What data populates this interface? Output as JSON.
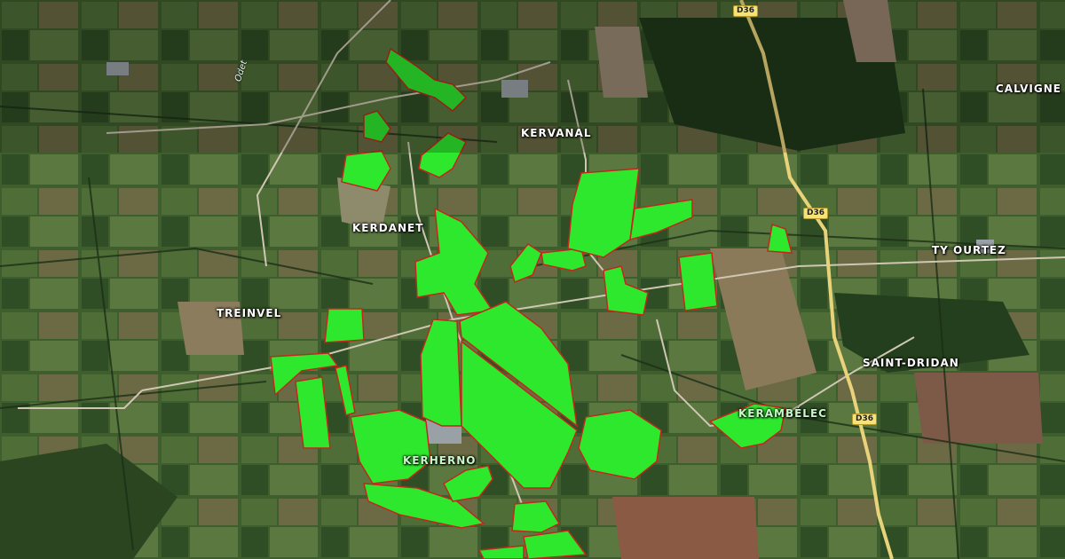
{
  "map": {
    "places": [
      {
        "id": "kervanal",
        "label": "KERVANAL"
      },
      {
        "id": "calvigne",
        "label": "CALVIGNE"
      },
      {
        "id": "kerdanet",
        "label": "KERDANET"
      },
      {
        "id": "ty-ourtez",
        "label": "TY OURTEZ"
      },
      {
        "id": "treinvel",
        "label": "TREINVEL"
      },
      {
        "id": "saint-dridan",
        "label": "SAINT-DRIDAN"
      },
      {
        "id": "kerambelec",
        "label": "KERAMBÉLEC"
      },
      {
        "id": "kerherno",
        "label": "KERHERNO"
      }
    ],
    "roads": [
      {
        "id": "d36-top",
        "label": "D36"
      },
      {
        "id": "d36-mid",
        "label": "D36"
      },
      {
        "id": "d36-bottom",
        "label": "D36"
      }
    ],
    "river": {
      "label": "Odet"
    },
    "colors": {
      "selected_field_fill": "#2ee82e",
      "selected_field_border": "#c0281e",
      "road": "#e9d37a"
    },
    "selected_fields_count": 27
  }
}
